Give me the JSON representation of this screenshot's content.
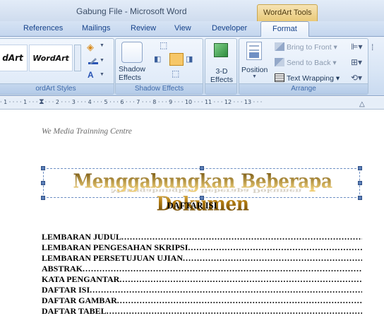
{
  "window": {
    "title": "Gabung File - Microsoft Word",
    "context_tools": "WordArt Tools"
  },
  "tabs": [
    {
      "label": "References"
    },
    {
      "label": "Mailings"
    },
    {
      "label": "Review"
    },
    {
      "label": "View"
    },
    {
      "label": "Developer"
    },
    {
      "label": "Format",
      "active": true
    }
  ],
  "ribbon": {
    "wordart_styles": {
      "sample1": "dArt",
      "sample2": "WordArt",
      "label": "ordArt Styles"
    },
    "shadow_effects": {
      "button_label": "Shadow Effects",
      "label": "Shadow Effects"
    },
    "effects_3d": {
      "button_label": "3-D Effects"
    },
    "arrange": {
      "position_label": "Position",
      "bring_to_front": "Bring to Front",
      "send_to_back": "Send to Back",
      "text_wrapping": "Text Wrapping",
      "label": "Arrange"
    }
  },
  "ruler": {
    "numbers": "· 1 · · · · 1 · · · 1 · · · 2 · · · 3 · · · 4 · · · 5 · · · 6 · · · 7 · · · 8 · · · 9 · · · 10 · · · 11 · · · 12 · · · 13 · · ·"
  },
  "document": {
    "header": "We Media Trainning Centre",
    "wordart": "Menggabungkan Beberapa Dokumen",
    "toc_title": "DAFTAR ISI",
    "toc_items": [
      {
        "label": "LEMBARAN JUDUL"
      },
      {
        "label": "LEMBARAN PENGESAHAN SKRIPSI"
      },
      {
        "label": "LEMBARAN PERSETUJUAN UJIAN"
      },
      {
        "label": "ABSTRAK"
      },
      {
        "label": "KATA PENGANTAR"
      },
      {
        "label": "DAFTAR ISI"
      },
      {
        "label": "DAFTAR GAMBAR"
      },
      {
        "label": "DAFTAR TABEL"
      }
    ]
  },
  "colors": {
    "ribbon_blue": "#d8e5f5",
    "context_gold": "#e9c978",
    "wordart_gold": "#c9951c"
  }
}
